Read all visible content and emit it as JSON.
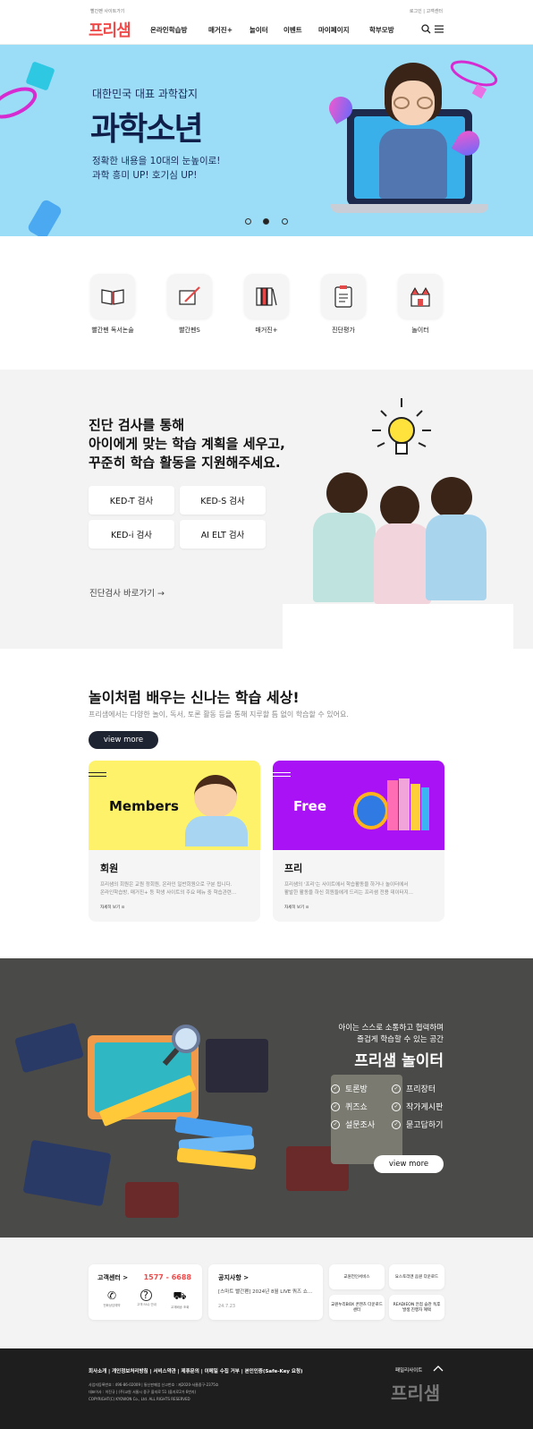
{
  "header": {
    "top_left": "빨간펜 사이트가기",
    "top_right": "로그인 | 고객센터",
    "logo": "프리샘",
    "nav": [
      "온라인학습방",
      "매거진+",
      "놀이터",
      "이벤트",
      "마이페이지",
      "학부모방"
    ]
  },
  "hero": {
    "subtitle": "대한민국 대표 과학잡지",
    "title": "과학소년",
    "line1": "정확한 내용을 10대의 눈높이로!",
    "line2": "과학 흥미 UP! 호기심 UP!",
    "active_slide": 2,
    "slide_count": 3
  },
  "quick": [
    {
      "label": "빨간펜 독서논술",
      "icon": "book-icon"
    },
    {
      "label": "빨간펜S",
      "icon": "pen-paper-icon"
    },
    {
      "label": "매거진+",
      "icon": "books-icon"
    },
    {
      "label": "진단평가",
      "icon": "clipboard-icon"
    },
    {
      "label": "놀이터",
      "icon": "castle-icon"
    }
  ],
  "diagnosis": {
    "line1": "진단 검사를 통해",
    "line2": "아이에게 맞는 학습 계획을 세우고,",
    "line3": "꾸준히 학습 활동을 지원해주세요.",
    "buttons": [
      "KED-T 검사",
      "KED-S 검사",
      "KED-i 검사",
      "AI ELT 검사"
    ],
    "link": "진단검사 바로가기"
  },
  "learning": {
    "title": "놀이처럼 배우는 신나는 학습 세상!",
    "desc": "프리샘에서는 다양한 놀이, 독서, 토론 활동 등을 통해 지루할 틈 없이 학습할 수 있어요.",
    "view_more": "view more",
    "cards": [
      {
        "banner": "Members",
        "title": "회원",
        "desc1": "프리샘의 회원은 교원 정회원, 온라인 일반회원으로 구분 됩니다.",
        "desc2": "온라인학습방, 매거진+ 등 학생 사이트의 주요 메뉴 중 학습관련...",
        "more": "자세히 보기",
        "color": "#fdf26a"
      },
      {
        "banner": "Free",
        "title": "프리",
        "desc1": "프리샘의 '프리'는 사이트에서 학습활동을 하거나 놀이터에서",
        "desc2": "활발한 활동을 하신 회원들에게 드리는 프리샘 전용 데이터지...",
        "more": "자세히 보기",
        "color": "#a812f5"
      }
    ]
  },
  "playground": {
    "line1": "아이는 스스로 소통하고 협력하며",
    "line2": "즐겁게 학습할 수 있는 공간",
    "title": "프리샘 놀이터",
    "items": [
      "토론방",
      "프리장터",
      "퀴즈쇼",
      "작가게시판",
      "설문조사",
      "묻고답하기"
    ],
    "view_more": "view more"
  },
  "support": {
    "title": "고객센터",
    "arrow": ">",
    "phone": "1577 - 6688",
    "icons": [
      "전화상담예약",
      "고객 FAQ 안내",
      "교재배송 조회"
    ],
    "notice_title": "공지사항",
    "notice_text": "[스마트 빨간펜] 2024년 8월 LIVE 쿼즈 쇼...",
    "notice_date": "24.7.23",
    "links": [
      "교원전인서비스",
      "요스토리엔 음원 다운로드",
      "교원누리BOX 콘텐츠 다운로드 센터",
      "READIEON 안점 습관 독후 발생 진행자 혜택"
    ]
  },
  "footer": {
    "links": "회사소개 | 개인정보처리방침 | 서비스약관 | 제휴문의 | 이메일 수집 거부 | 본인인증(Safe-Key 요청)",
    "addr1": "사업자등록번호 : 496-86-02009 | 통신판매업 신고번호 : 제2020-서울중구-2375호",
    "addr2": "대표이사 : 이진규 | (주)교원 서울시 중구 을지로 51 (을지로2가 6번지)",
    "copyright": "COPYRIGHT(C) KYOWON Co., Ltd. ALL RIGHTS RESERVED",
    "family": "패밀리사이트",
    "logo": "프리샘"
  }
}
